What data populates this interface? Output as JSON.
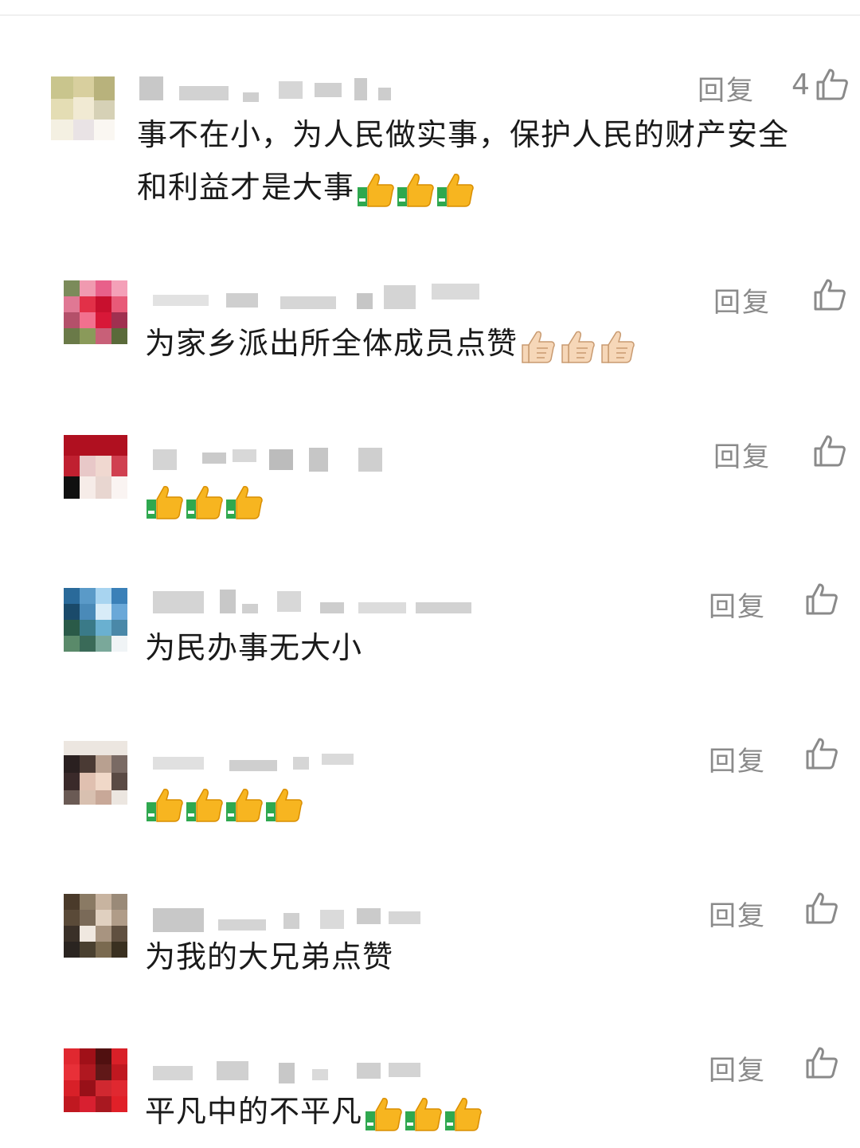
{
  "comments": [
    {
      "reply_label": "回复",
      "like_count": "4",
      "text": "事不在小，为人民做实事，保护人民的财产安全",
      "text2": "和利益才是大事",
      "emoji": "👍👍👍"
    },
    {
      "reply_label": "回复",
      "like_count": "",
      "text": "为家乡派出所全体成员点赞",
      "emoji": "👍🏻👍🏻👍🏻"
    },
    {
      "reply_label": "回复",
      "like_count": "",
      "text": "",
      "emoji": "👍👍👍"
    },
    {
      "reply_label": "回复",
      "like_count": "",
      "text": "为民办事无大小",
      "emoji": ""
    },
    {
      "reply_label": "回复",
      "like_count": "",
      "text": "",
      "emoji": "👍👍👍👍"
    },
    {
      "reply_label": "回复",
      "like_count": "",
      "text": "为我的大兄弟点赞",
      "emoji": ""
    },
    {
      "reply_label": "回复",
      "like_count": "",
      "text": "平凡中的不平凡",
      "emoji": "👍👍👍"
    }
  ],
  "icons": {
    "like": "thumbs-up-outline-icon",
    "emoji": "thumbs-up-emoji-icon"
  }
}
